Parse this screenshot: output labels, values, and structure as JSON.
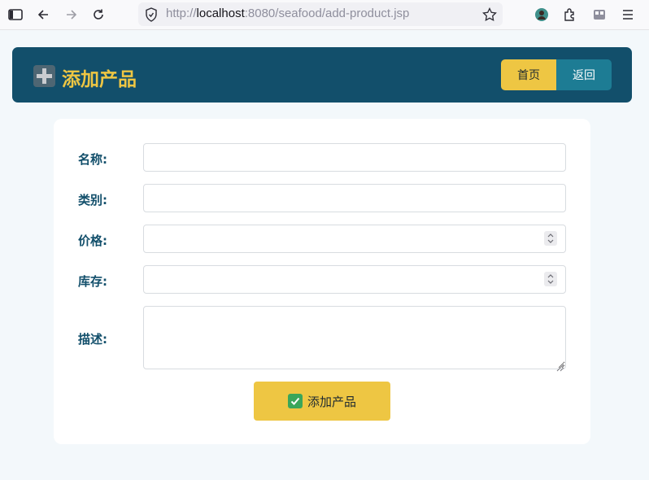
{
  "browser": {
    "url_scheme": "http://",
    "url_host": "localhost",
    "url_rest": ":8080/seafood/add-product.jsp"
  },
  "icons": {
    "sidebar": "sidebar-toggle-icon",
    "back": "arrow-left-icon",
    "forward": "arrow-right-icon",
    "reload": "reload-icon",
    "security": "shield-icon",
    "bookmark": "star-icon",
    "profile": "avatar-icon",
    "extensions": "puzzle-icon",
    "container": "container-icon",
    "menu": "hamburger-menu-icon",
    "header": "plus-icon",
    "submit": "check-icon"
  },
  "colors": {
    "header_bg": "#124f6b",
    "accent": "#eec643",
    "secondary_button": "#1d7c94",
    "page_bg": "#f3f8fb"
  },
  "header": {
    "title": "添加产品",
    "home_label": "首页",
    "back_label": "返回"
  },
  "form": {
    "name_label": "名称:",
    "name_value": "",
    "category_label": "类别:",
    "category_value": "",
    "price_label": "价格:",
    "price_value": "",
    "stock_label": "库存:",
    "stock_value": "",
    "description_label": "描述:",
    "description_value": "",
    "submit_label": "添加产品"
  }
}
